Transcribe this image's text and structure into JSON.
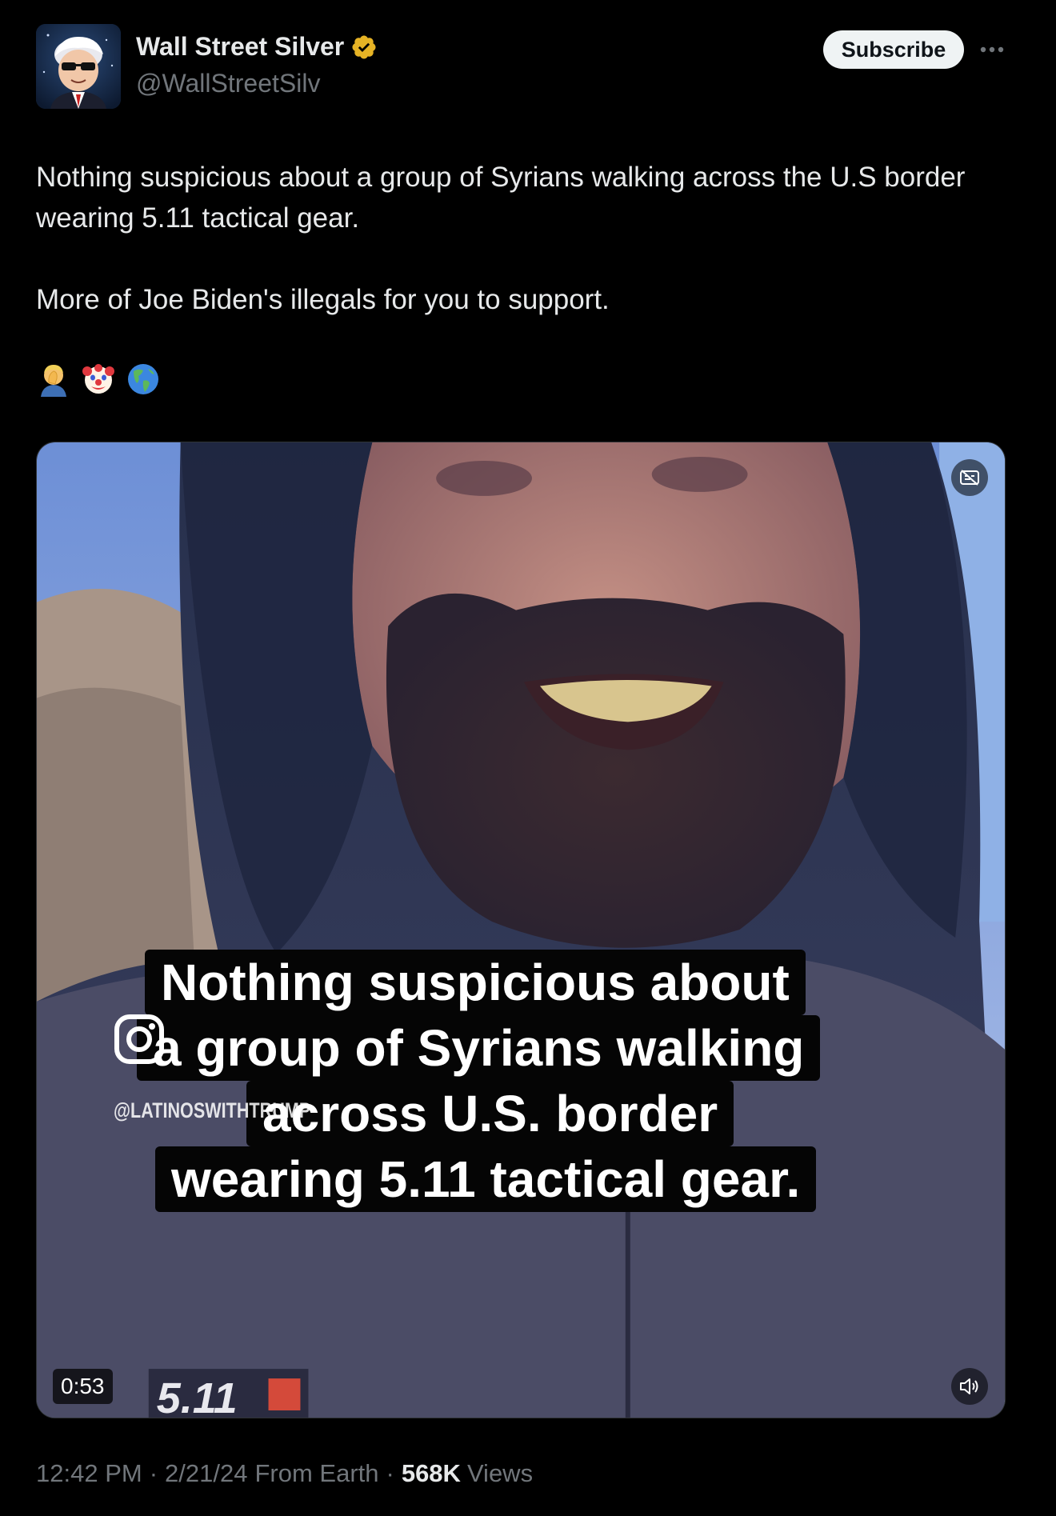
{
  "author": {
    "name": "Wall Street Silver",
    "handle": "@WallStreetSilv",
    "verified_color": "#e6b325"
  },
  "header": {
    "subscribe_label": "Subscribe",
    "more_icon": "more-horizontal-icon"
  },
  "tweet": {
    "paragraph1": "Nothing suspicious about a group of Syrians walking across the U.S border wearing 5.11 tactical gear.",
    "paragraph2": "More of Joe Biden's illegals for you to support.",
    "emojis": [
      "man-facepalming",
      "clown-face",
      "globe-americas"
    ]
  },
  "video": {
    "caption_lines": [
      "Nothing suspicious about",
      "a group of Syrians walking",
      "across U.S. border",
      "wearing 5.11 tactical gear."
    ],
    "watermark": "@LATINOSWITHTRUMP",
    "duration": "0:53",
    "captions_icon": "captions-off-icon",
    "volume_icon": "volume-icon"
  },
  "meta": {
    "time": "12:42 PM",
    "date": "2/21/24",
    "source": "From Earth",
    "separator": "·",
    "views_count": "568K",
    "views_label": "Views"
  },
  "colors": {
    "background": "#000000",
    "text": "#e7e9ea",
    "secondary": "#71767b",
    "button_bg": "#eff3f4"
  }
}
